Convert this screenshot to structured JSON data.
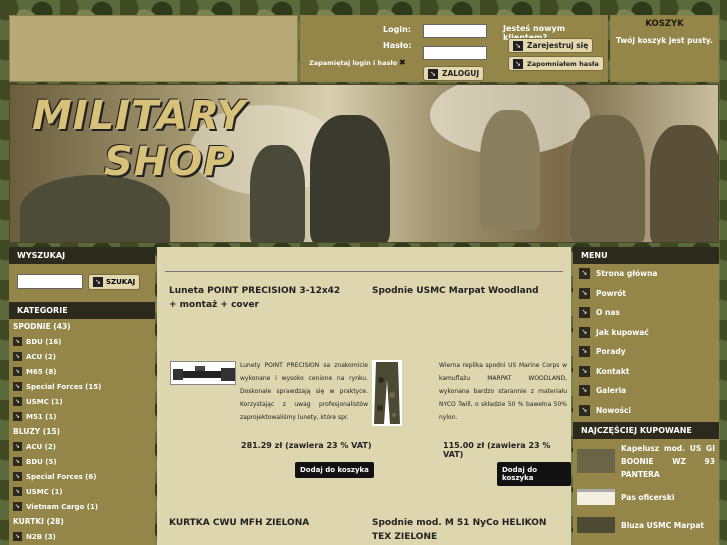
{
  "header": {
    "login_label": "Login:",
    "password_label": "Hasło:",
    "remember_label": "Zapamiętaj login i hasło",
    "remember_mark": "✖",
    "login_button": "ZALOGUJ",
    "new_client": "Jesteś nowym klientem?",
    "register_button": "Zarejestruj się",
    "forgot_button": "Zapomniałem hasła",
    "cart_title": "KOSZYK",
    "cart_status": "Twój koszyk jest pusty."
  },
  "banner": {
    "logo_line1": "MILITARY",
    "logo_line2": "SHOP"
  },
  "sidebar": {
    "search_title": "WYSZUKAJ",
    "search_button": "SZUKAJ",
    "categories_title": "KATEGORIE",
    "categories": [
      {
        "label": "SPODNIE (43)",
        "type": "head"
      },
      {
        "label": "BDU (16)",
        "type": "sub"
      },
      {
        "label": "ACU (2)",
        "type": "sub"
      },
      {
        "label": "M65 (8)",
        "type": "sub"
      },
      {
        "label": "Special Forces (15)",
        "type": "sub"
      },
      {
        "label": "USMC (1)",
        "type": "sub"
      },
      {
        "label": "M51 (1)",
        "type": "sub"
      },
      {
        "label": "BLUZY (15)",
        "type": "head"
      },
      {
        "label": "ACU (2)",
        "type": "sub"
      },
      {
        "label": "BDU (5)",
        "type": "sub"
      },
      {
        "label": "Special Forces (6)",
        "type": "sub"
      },
      {
        "label": "USMC (1)",
        "type": "sub"
      },
      {
        "label": "Vietnam Cargo (1)",
        "type": "sub"
      },
      {
        "label": "KURTKI (28)",
        "type": "head"
      },
      {
        "label": "N2B (3)",
        "type": "sub"
      }
    ]
  },
  "products": [
    {
      "title": "Luneta POINT PRECISION 3-12x42 + montaż + cover",
      "desc": "Lunety POINT PRECISION sa znakomicie wykonane i wysoko cenione na rynku. Doskonale sprawdzają się w praktyce. Korzystając z uwag profesjonalistów zaprojektowaliśmy lunety, które spr.",
      "price": "281.29 zł (zawiera 23 % VAT)",
      "add": "Dodaj do koszyka"
    },
    {
      "title": "Spodnie USMC Marpat Woodland",
      "desc": "Wierna replika spodni US Marine Corps w kamuflażu MARPAT WOODLAND, wykonana bardzo starannie z materiału NYCO Twill, o składzie 50 % bawełna 50% nylon.",
      "price": "115.00 zł (zawiera 23 % VAT)",
      "add": "Dodaj do koszyka"
    },
    {
      "title": "KURTKA CWU MFH ZIELONA"
    },
    {
      "title": "Spodnie mod. M 51 NyCo HELIKON TEX ZIELONE"
    }
  ],
  "menu": {
    "title": "MENU",
    "items": [
      "Strona główna",
      "Powrót",
      "O nas",
      "Jak kupować",
      "Porady",
      "Kontakt",
      "Galeria",
      "Nowości"
    ]
  },
  "popular": {
    "title": "NAJCZĘŚCIEJ KUPOWANE",
    "items": [
      "Kapelusz mod. US GI BOONIE WZ 93 PANTERA",
      "Pas oficerski",
      "Bluza USMC Marpat"
    ]
  },
  "colors": {
    "olive": "#948548",
    "dark": "#2b2a1c",
    "content_bg": "#ded6ae"
  }
}
